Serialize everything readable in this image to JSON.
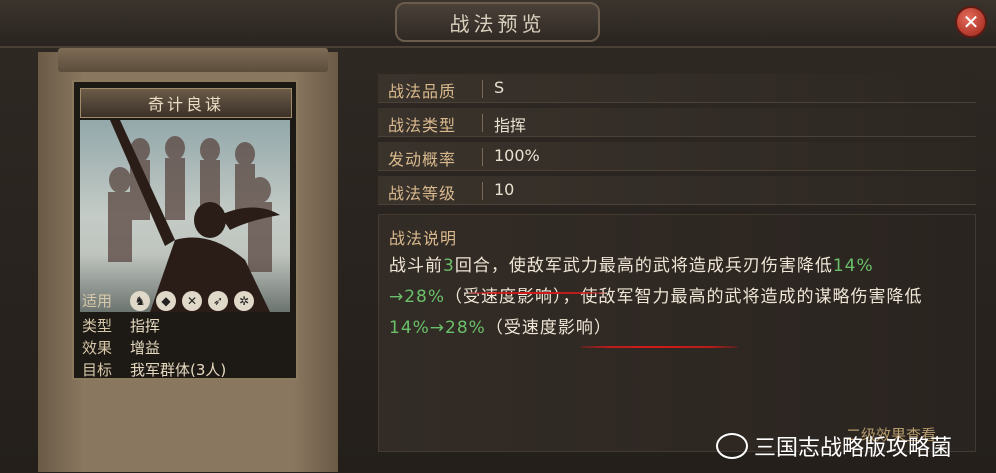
{
  "title": "战法预览",
  "close_icon": "close-icon",
  "card": {
    "name": "奇计良谋",
    "attrs": [
      {
        "key": "适用",
        "value": ""
      },
      {
        "key": "类型",
        "value": "指挥"
      },
      {
        "key": "效果",
        "value": "增益"
      },
      {
        "key": "目标",
        "value": "我军群体(3人)"
      }
    ],
    "unit_icons": [
      "cavalry-icon",
      "shield-icon",
      "archer-icon",
      "spear-icon",
      "wheel-icon"
    ]
  },
  "props": [
    {
      "key": "战法品质",
      "value": "S"
    },
    {
      "key": "战法类型",
      "value": "指挥"
    },
    {
      "key": "发动概率",
      "value": "100%"
    },
    {
      "key": "战法等级",
      "value": "10"
    }
  ],
  "desc": {
    "heading": "战法说明",
    "p1": "战斗前",
    "n1": "3",
    "p2": "回合，使敌军武力最高的武将造成兵刃伤害降低",
    "v1": "14%",
    "p3": "",
    "v2": "→28%",
    "p4": "（受速度影响），使敌军智力最高的武将造成的谋略伤害降低",
    "v3": "14%→28%",
    "p5": "（受速度影响）"
  },
  "footer_link": "二级效果查看",
  "watermark": "三国志战略版攻略菌"
}
